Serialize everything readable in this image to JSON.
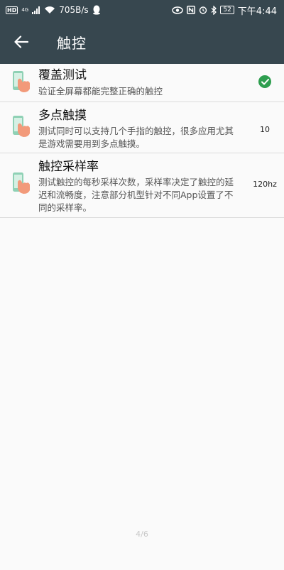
{
  "status_bar": {
    "hd": "HD",
    "network": "4G",
    "speed": "705B/s",
    "battery": "52",
    "time": "下午4:44",
    "icons": [
      "hd-icon",
      "signal-icon",
      "wifi-icon",
      "qq-icon",
      "eye-icon",
      "nfc-icon",
      "alarm-icon",
      "bluetooth-icon",
      "battery-icon"
    ]
  },
  "app_bar": {
    "back_icon": "arrow-left-icon",
    "title": "触控"
  },
  "items": [
    {
      "title": "覆盖测试",
      "desc": "验证全屏幕都能完整正确的触控",
      "icon": "touch-hand-icon",
      "status_icon": "check-circle-icon"
    },
    {
      "title": "多点触摸",
      "desc": "测试同时可以支持几个手指的触控，很多应用尤其是游戏需要用到多点触摸。",
      "icon": "touch-hand-icon",
      "value": "10"
    },
    {
      "title": "触控采样率",
      "desc": "测试触控的每秒采样次数，采样率决定了触控的延迟和流畅度，注意部分机型针对不同App设置了不同的采样率。",
      "icon": "touch-hand-icon",
      "value": "120hz"
    }
  ],
  "page_indicator": "4/6",
  "colors": {
    "app_bar": "#37474f",
    "check": "#2e9e4f",
    "background": "#fafafa",
    "icon_phone": "#8fd1b5",
    "icon_hand": "#f29a7a"
  }
}
